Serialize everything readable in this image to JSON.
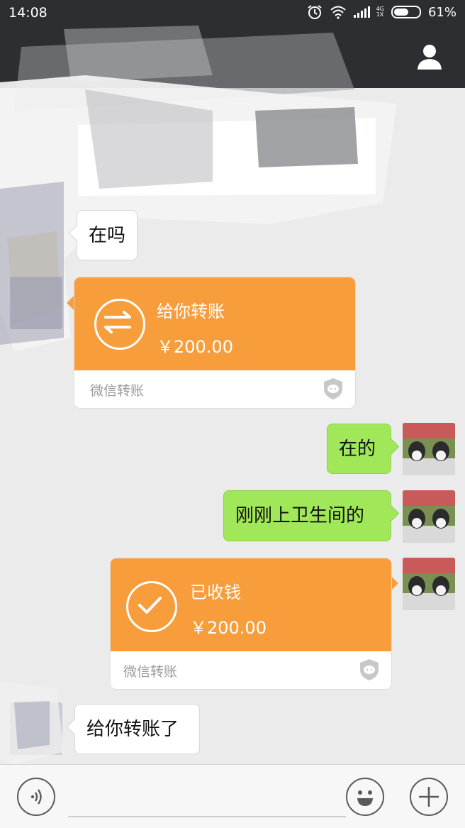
{
  "status_bar": {
    "time": "14:08",
    "network_top": "4G",
    "network_bottom": "1X",
    "battery": "61%",
    "battery_level": 0.61
  },
  "messages": {
    "msg_zai_ma": "在吗",
    "transfer_1_title": "给你转账",
    "transfer_1_amount": "￥200.00",
    "transfer_1_footer": "微信转账",
    "msg_zai_de": "在的",
    "msg_gang_gang": "刚刚上卫生间的",
    "transfer_2_title": "已收钱",
    "transfer_2_amount": "￥200.00",
    "transfer_2_footer": "微信转账",
    "msg_gei_ni": "给你转账了"
  },
  "colors": {
    "header": "#2d2e31",
    "chat_bg": "#ebebeb",
    "green_bubble": "#a0e75a",
    "transfer_orange": "#f79d3b"
  },
  "icons": {
    "alarm": "alarm-icon",
    "wifi": "wifi-icon",
    "signal": "signal-icon",
    "battery": "battery-icon",
    "profile": "profile-icon",
    "transfer": "transfer-arrows-icon",
    "received": "checkmark-icon",
    "shield": "shield-icon",
    "voice": "voice-icon",
    "emoji": "emoji-icon",
    "plus": "plus-icon"
  }
}
